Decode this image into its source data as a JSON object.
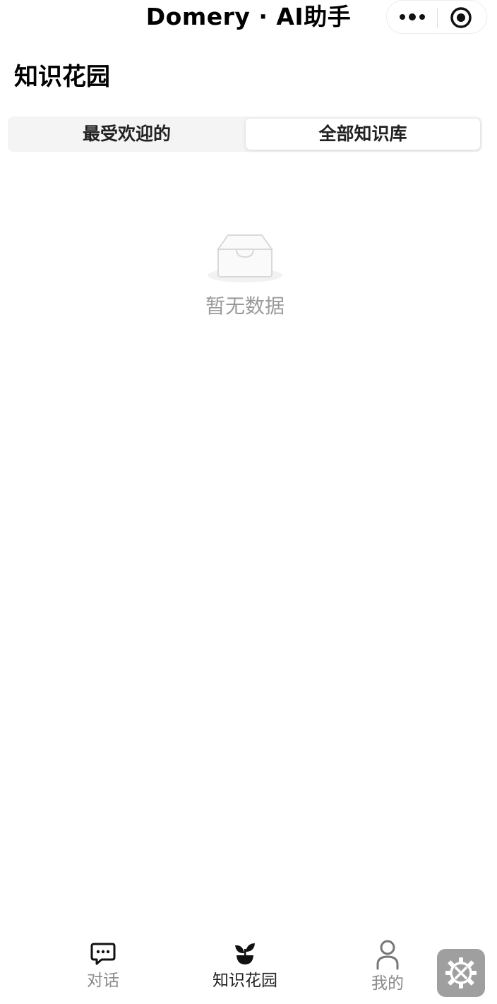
{
  "titlebar": {
    "title": "Domery · AI助手",
    "more_icon": "more-dots-icon",
    "close_icon": "target-close-icon"
  },
  "page": {
    "heading": "知识花园"
  },
  "tabs": [
    {
      "label": "最受欢迎的",
      "selected": false
    },
    {
      "label": "全部知识库",
      "selected": true
    }
  ],
  "empty_state": {
    "icon": "empty-inbox-icon",
    "text": "暂无数据"
  },
  "tabbar": {
    "items": [
      {
        "label": "对话",
        "icon": "chat-bubble-icon",
        "active": false
      },
      {
        "label": "知识花园",
        "icon": "sprout-icon",
        "active": true
      },
      {
        "label": "我的",
        "icon": "user-icon",
        "active": false
      }
    ]
  },
  "floating_tool": {
    "icon": "tools-gear-icon"
  },
  "colors": {
    "background": "#ffffff",
    "segmented_bg": "#f4f4f4",
    "muted_text": "#9a9a9a",
    "floating_bg": "#9f9f9f"
  }
}
